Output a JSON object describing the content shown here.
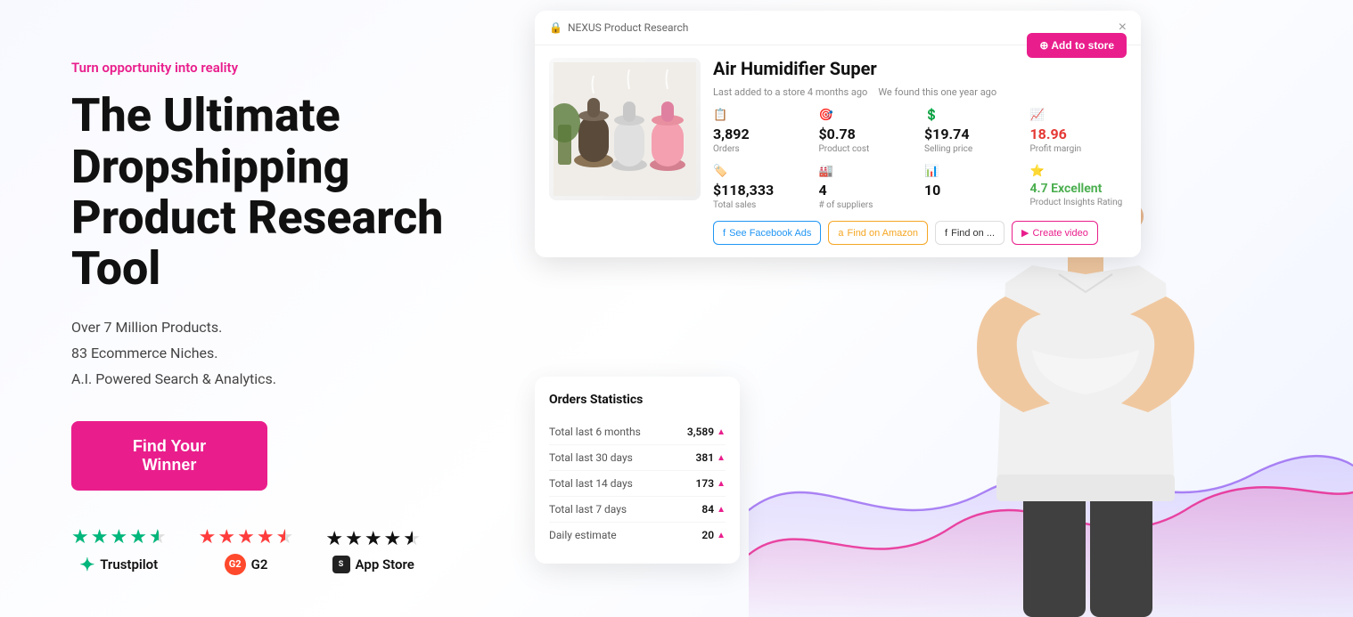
{
  "left": {
    "tagline": "Turn opportunity into reality",
    "title": "The Ultimate Dropshipping Product Research Tool",
    "subtitle_lines": [
      "Over 7 Million Products.",
      "83 Ecommerce Niches.",
      "A.I. Powered Search & Analytics."
    ],
    "cta_label": "Find Your Winner",
    "ratings": [
      {
        "platform": "Trustpilot",
        "stars": 4.5,
        "star_type": "green",
        "icon": "trustpilot"
      },
      {
        "platform": "G2",
        "stars": 4.5,
        "star_type": "red",
        "icon": "g2"
      },
      {
        "platform": "App Store",
        "stars": 4.5,
        "star_type": "black",
        "icon": "shopify"
      }
    ]
  },
  "product_card": {
    "header_label": "NEXUS Product Research",
    "close": "×",
    "product_name": "Air Humidifier Super",
    "meta1": "Last added to a store 4 months ago",
    "meta2": "We found this one year ago",
    "add_to_store": "Add to store",
    "stats": [
      {
        "icon": "📋",
        "value": "3,892",
        "label": "Orders"
      },
      {
        "icon": "🎯",
        "value": "$0.78",
        "label": "Product cost"
      },
      {
        "icon": "💲",
        "value": "$19.74",
        "label": "Selling price"
      },
      {
        "icon": "📈",
        "value": "18.96",
        "label": "Profit margin",
        "trend": "down"
      }
    ],
    "stats2": [
      {
        "icon": "🏷️",
        "value": "$118,333",
        "label": "Total sales"
      },
      {
        "icon": "🏭",
        "value": "4",
        "label": "# of suppliers"
      },
      {
        "icon": "📊",
        "value": "10",
        "label": ""
      },
      {
        "icon": "⭐",
        "value": "4.7 Excellent",
        "label": "Product Insights Rating",
        "excellent": true
      }
    ],
    "actions": [
      {
        "label": "See Facebook Ads",
        "style": "blue"
      },
      {
        "label": "Find on Amazon",
        "style": "orange"
      },
      {
        "label": "Find on ...",
        "style": "plain"
      },
      {
        "label": "Create video",
        "style": "pink"
      }
    ]
  },
  "orders_stats": {
    "title": "Orders Statistics",
    "rows": [
      {
        "label": "Total last 6 months",
        "value": "3,589",
        "trend": "up"
      },
      {
        "label": "Total last 30 days",
        "value": "381",
        "trend": "up"
      },
      {
        "label": "Total last 14 days",
        "value": "173",
        "trend": "up"
      },
      {
        "label": "Total last 7 days",
        "value": "84",
        "trend": "up"
      },
      {
        "label": "Daily estimate",
        "value": "20",
        "trend": "up"
      }
    ]
  },
  "accent_color": "#e91e8c",
  "brand_colors": {
    "trustpilot": "#00b67a",
    "g2": "#ff492c",
    "shopify": "#222222"
  }
}
